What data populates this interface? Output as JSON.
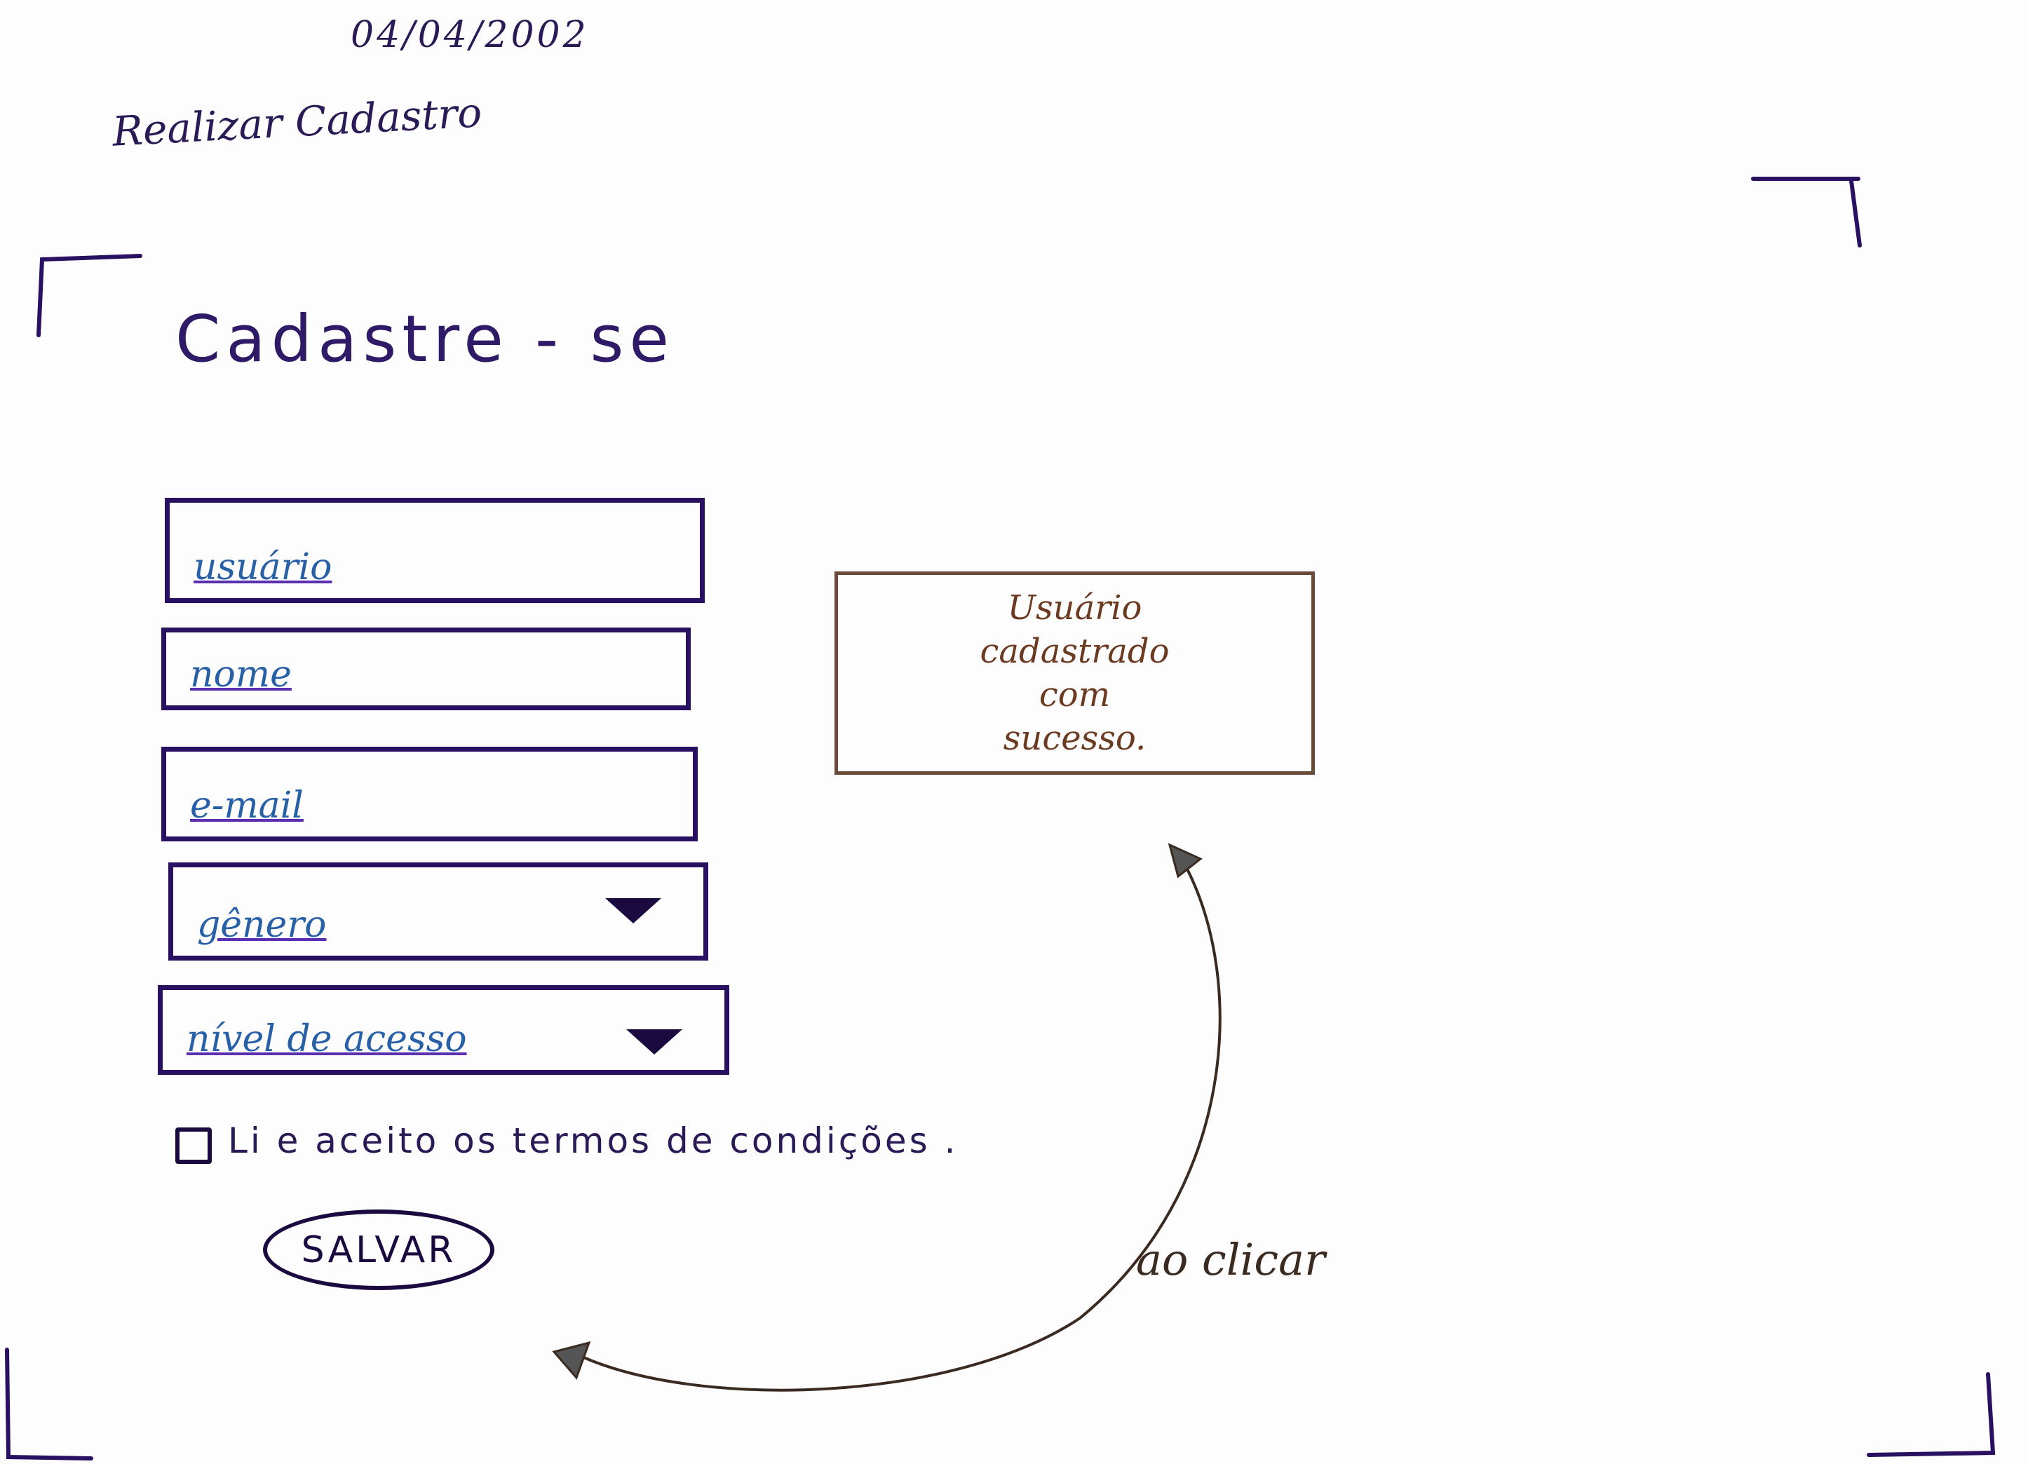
{
  "header": {
    "date": "04/04/2002",
    "subtitle": "Realizar Cadastro"
  },
  "form": {
    "title": "Cadastre - se",
    "fields": [
      {
        "placeholder": "usuário",
        "type": "text"
      },
      {
        "placeholder": "nome",
        "type": "text"
      },
      {
        "placeholder": "e-mail",
        "type": "text"
      },
      {
        "placeholder": "gênero",
        "type": "select"
      },
      {
        "placeholder": "nível de acesso",
        "type": "select"
      }
    ],
    "terms_label": "Li e aceito os termos de condições .",
    "save_label": "SALVAR"
  },
  "success_message": {
    "lines": [
      "Usuário",
      "cadastrado",
      "com",
      "sucesso."
    ]
  },
  "annotation": {
    "on_click": "ao clicar"
  },
  "colors": {
    "ink": "#2a1060",
    "placeholder": "#2860a8",
    "message": "#6b3a20"
  }
}
